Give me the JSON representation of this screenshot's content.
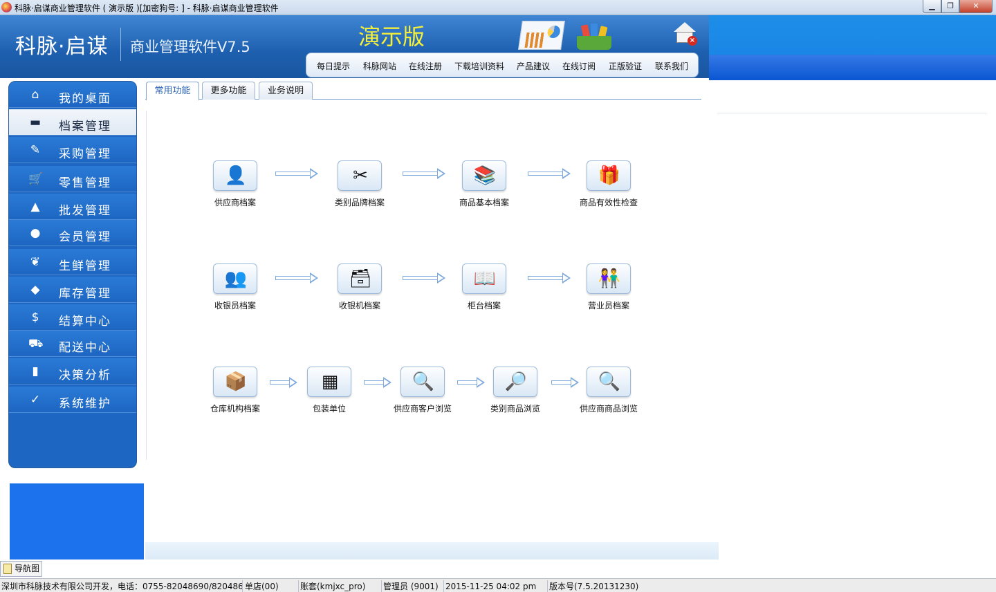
{
  "window": {
    "title": "科脉·启谋商业管理软件 ( 演示版 )[加密狗号: ] - 科脉·启谋商业管理软件",
    "min": "▁",
    "max": "❐",
    "close": "✕"
  },
  "header": {
    "logo": "科脉·启谋",
    "subtitle": "商业管理软件V7.5",
    "demo": "演示版",
    "home_icon": "home-exit-icon"
  },
  "topnav": [
    "每日提示",
    "科脉网站",
    "在线注册",
    "下载培训资料",
    "产品建议",
    "在线订阅",
    "正版验证",
    "联系我们"
  ],
  "sidebar": {
    "items": [
      {
        "label": "我的桌面",
        "icon": "home-icon",
        "glyph": "⌂"
      },
      {
        "label": "档案管理",
        "icon": "folder-icon",
        "glyph": "▬"
      },
      {
        "label": "采购管理",
        "icon": "edit-icon",
        "glyph": "✎"
      },
      {
        "label": "零售管理",
        "icon": "cart-icon",
        "glyph": "🛒"
      },
      {
        "label": "批发管理",
        "icon": "bag-icon",
        "glyph": "▲"
      },
      {
        "label": "会员管理",
        "icon": "user-icon",
        "glyph": "●"
      },
      {
        "label": "生鲜管理",
        "icon": "leaf-icon",
        "glyph": "❦"
      },
      {
        "label": "库存管理",
        "icon": "box-icon",
        "glyph": "◆"
      },
      {
        "label": "结算中心",
        "icon": "dollar-icon",
        "glyph": "$"
      },
      {
        "label": "配送中心",
        "icon": "truck-icon",
        "glyph": "⛟"
      },
      {
        "label": "决策分析",
        "icon": "chart-icon",
        "glyph": "▮"
      },
      {
        "label": "系统维护",
        "icon": "shield-icon",
        "glyph": "✓"
      }
    ]
  },
  "tabs": [
    "常用功能",
    "更多功能",
    "业务说明"
  ],
  "functions": {
    "row1": [
      {
        "label": "供应商档案",
        "icon": "supplier-icon",
        "glyph": "👤"
      },
      {
        "label": "类别品牌档案",
        "icon": "category-brand-icon",
        "glyph": "✂"
      },
      {
        "label": "商品基本档案",
        "icon": "product-book-icon",
        "glyph": "📚"
      },
      {
        "label": "商品有效性检查",
        "icon": "product-check-icon",
        "glyph": "🎁"
      }
    ],
    "row2": [
      {
        "label": "收银员档案",
        "icon": "cashier-icon",
        "glyph": "👥"
      },
      {
        "label": "收银机档案",
        "icon": "pos-machine-icon",
        "glyph": "🗃"
      },
      {
        "label": "柜台档案",
        "icon": "counter-icon",
        "glyph": "📖"
      },
      {
        "label": "营业员档案",
        "icon": "clerk-icon",
        "glyph": "👫"
      }
    ],
    "row3": [
      {
        "label": "仓库机构档案",
        "icon": "warehouse-icon",
        "glyph": "📦"
      },
      {
        "label": "包装单位",
        "icon": "package-icon",
        "glyph": "▦"
      },
      {
        "label": "供应商客户浏览",
        "icon": "supplier-browse-icon",
        "glyph": "🔍"
      },
      {
        "label": "类别商品浏览",
        "icon": "category-browse-icon",
        "glyph": "🔎"
      },
      {
        "label": "供应商商品浏览",
        "icon": "supplier-product-browse-icon",
        "glyph": "🔍"
      }
    ]
  },
  "navtab": "导航图",
  "status": {
    "company": "深圳市科脉技术有限公司开发，电话：0755-82048690/8204869",
    "store": "单店(00)",
    "account": "账套(kmjxc_pro)",
    "operator": "管理员 (9001)",
    "datetime": "2015-11-25 04:02 pm",
    "version": "版本号(7.5.20131230)"
  },
  "colors": {
    "header_blue": "#1d5fae",
    "sidebar_blue": "#1d66c2",
    "demo_yellow": "#f3ef3a",
    "arrow": "#7ea9dc"
  }
}
